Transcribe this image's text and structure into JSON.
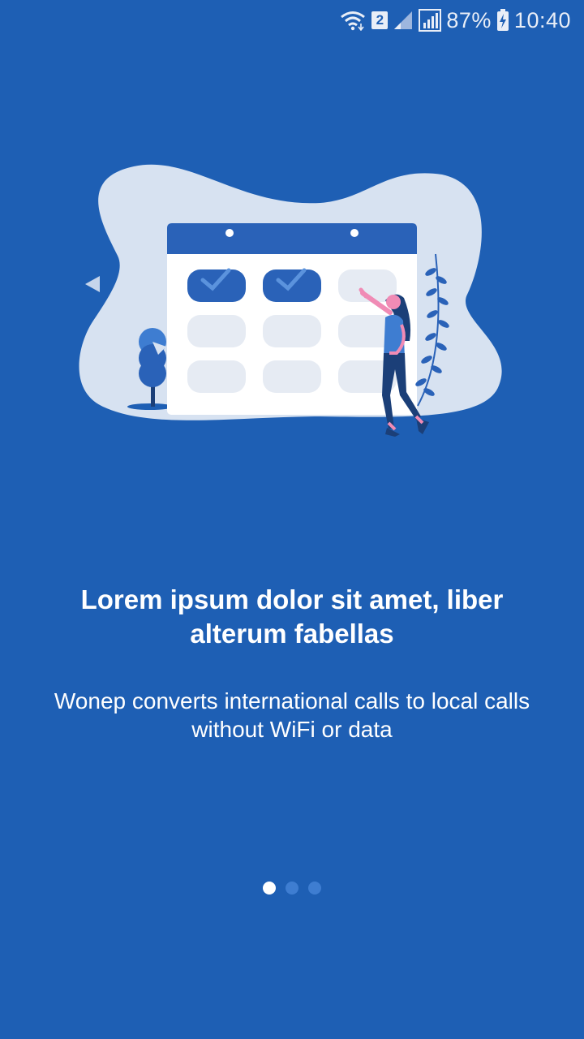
{
  "status_bar": {
    "sim_number": "2",
    "battery": "87%",
    "time": "10:40",
    "icons": [
      "wifi-icon",
      "sim-badge",
      "signal-weak-icon",
      "signal-icon",
      "battery-charging-icon"
    ]
  },
  "onboarding": {
    "illustration": "calendar-woman-illustration",
    "headline": "Lorem ipsum dolor sit amet, liber alterum fabellas",
    "subtitle": "Wonep converts international calls to local calls without WiFi or data",
    "pager": {
      "total_pages": 3,
      "current_page": 1
    }
  },
  "colors": {
    "background": "#1E5FB4",
    "blob": "#D7E2F1",
    "accent": "#2A62B8",
    "text": "#FFFFFF",
    "dot_inactive": "#3E7DD1",
    "dot_active": "#FFFFFF"
  }
}
